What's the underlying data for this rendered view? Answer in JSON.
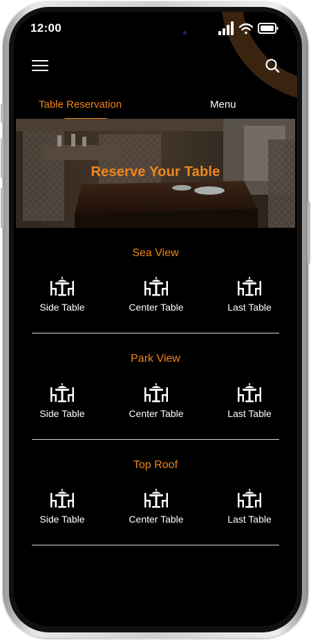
{
  "status_bar": {
    "time": "12:00"
  },
  "tabs": [
    {
      "label": "Table Reservation",
      "active": true
    },
    {
      "label": "Menu",
      "active": false
    }
  ],
  "banner": {
    "title": "Reserve Your Table"
  },
  "sections": [
    {
      "title": "Sea View",
      "tables": [
        "Side Table",
        "Center Table",
        "Last Table"
      ]
    },
    {
      "title": "Park View",
      "tables": [
        "Side Table",
        "Center Table",
        "Last Table"
      ]
    },
    {
      "title": "Top Roof",
      "tables": [
        "Side Table",
        "Center Table",
        "Last Table"
      ]
    }
  ],
  "colors": {
    "accent": "#f0871b",
    "background": "#000000",
    "text": "#ffffff"
  },
  "icons": {
    "menu": "hamburger-icon",
    "search": "search-icon",
    "table": "dining-table-icon"
  }
}
